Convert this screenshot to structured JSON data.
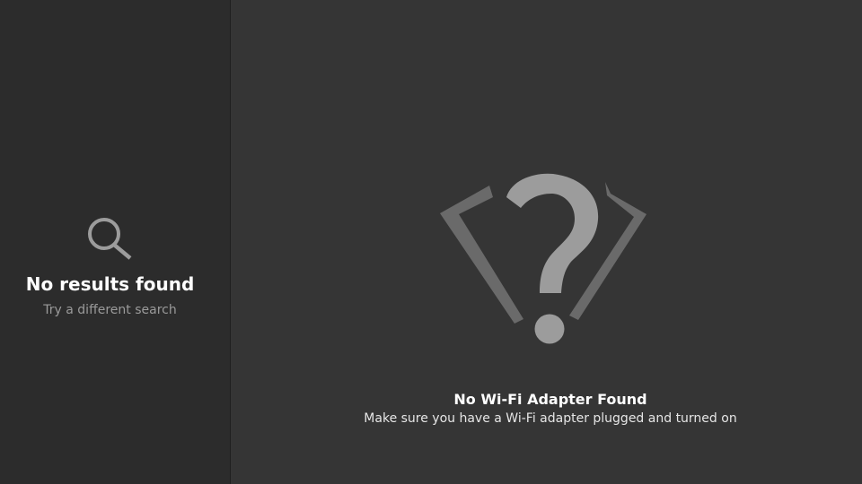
{
  "sidebar": {
    "empty_state": {
      "icon": "search-icon",
      "title": "No results found",
      "subtitle": "Try a different search"
    }
  },
  "main": {
    "empty_state": {
      "icon": "wifi-adapter-question-icon",
      "title": "No Wi-Fi Adapter Found",
      "subtitle": "Make sure you have a Wi-Fi adapter plugged and turned on"
    }
  },
  "colors": {
    "background": "#353535",
    "sidebar_background": "#2c2c2c",
    "icon_light": "#9c9c9c",
    "icon_dark": "#6a6a6a",
    "title_text": "#ffffff",
    "secondary_text": "#9a9a9a"
  }
}
